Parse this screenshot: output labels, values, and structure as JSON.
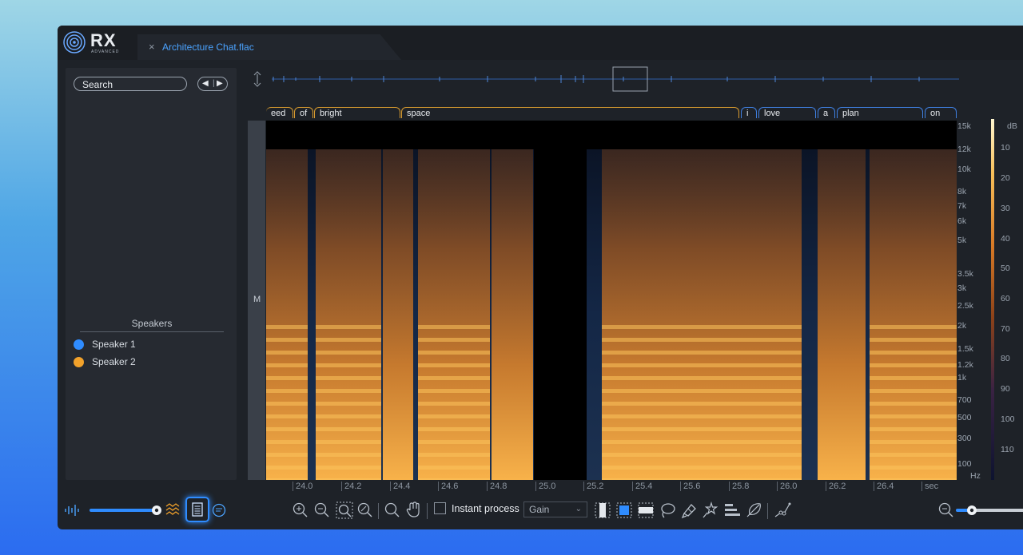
{
  "app": {
    "logo_text": "RX",
    "logo_subtitle": "ADVANCED"
  },
  "tab": {
    "close_glyph": "×",
    "file_name": "Architecture Chat.flac"
  },
  "sidebar": {
    "search_label": "Search",
    "prev_glyph": "◀",
    "next_glyph": "▶",
    "speakers_title": "Speakers",
    "speakers": [
      {
        "name": "Speaker 1",
        "color": "#2f8cff"
      },
      {
        "name": "Speaker 2",
        "color": "#f2a22b"
      }
    ]
  },
  "transcript_words": [
    "eed",
    "of",
    "bright",
    "space",
    "i",
    "love",
    "a",
    "plan",
    "on"
  ],
  "channel_label": "M",
  "freq_axis": [
    "15k",
    "12k",
    "10k",
    "8k",
    "7k",
    "6k",
    "5k",
    "3.5k",
    "3k",
    "2.5k",
    "2k",
    "1.5k",
    "1.2k",
    "1k",
    "700",
    "500",
    "300",
    "100",
    "Hz"
  ],
  "db_axis": [
    "dB",
    "10",
    "20",
    "30",
    "40",
    "50",
    "60",
    "70",
    "80",
    "90",
    "100",
    "110"
  ],
  "time_axis": {
    "ticks": [
      "24.0",
      "24.2",
      "24.4",
      "24.6",
      "24.8",
      "25.0",
      "25.2",
      "25.4",
      "25.6",
      "25.8",
      "26.0",
      "26.2",
      "26.4"
    ],
    "unit": "sec"
  },
  "toolbar": {
    "instant_process_label": "Instant process",
    "gain_option": "Gain",
    "transcript_view_active": true
  },
  "colors": {
    "accent": "#2f8cff",
    "speaker2": "#f2a22b",
    "background": "#1e2228"
  }
}
